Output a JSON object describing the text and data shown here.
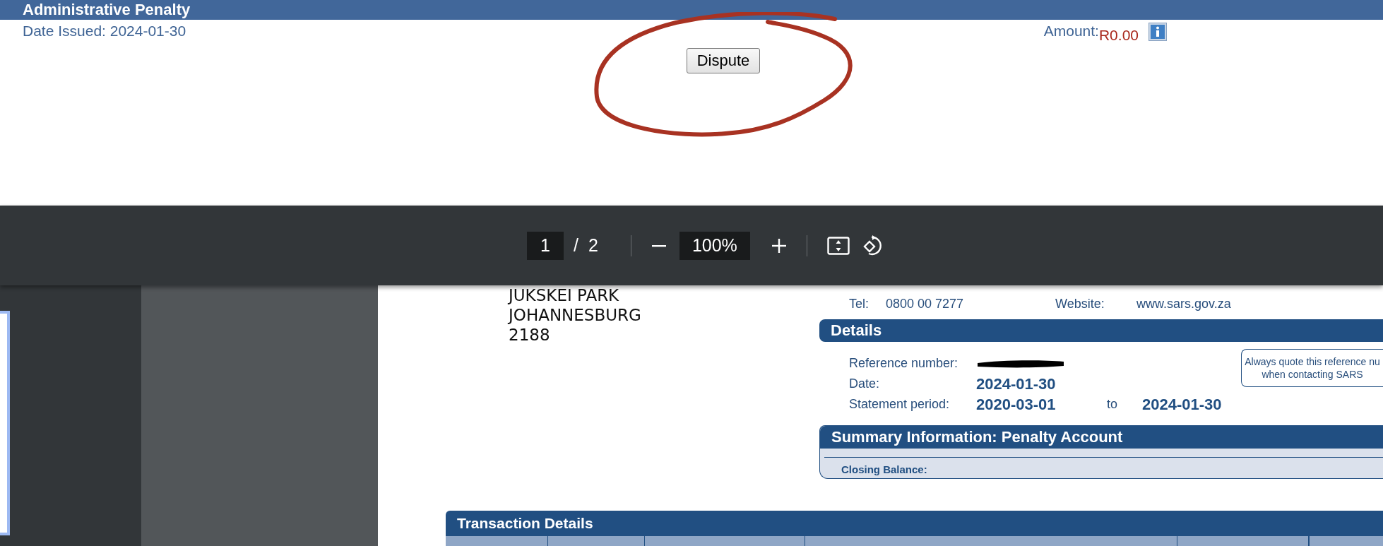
{
  "header": {
    "title": "Administrative Penalty",
    "date_issued": "Date Issued: 2024-01-30",
    "amount_label": "Amount:",
    "amount_value": "R0.00"
  },
  "dispute_button": {
    "label": "Dispute"
  },
  "pdf_toolbar": {
    "page_current": "1",
    "page_separator": "/",
    "page_total": "2",
    "zoom": "100%"
  },
  "sidebar": {
    "thumbnails": [
      {
        "selected": true
      }
    ]
  },
  "document": {
    "address_lines": [
      "JUKSKEI PARK",
      "JOHANNESBURG",
      "2188"
    ],
    "contact": [
      {
        "label": "Tel:",
        "value": "0800 00 7277"
      },
      {
        "label": "Website:",
        "value": "www.sars.gov.za"
      }
    ],
    "details": {
      "heading": "Details",
      "rows": [
        {
          "kind": "redacted",
          "label": "Reference number:"
        },
        {
          "kind": "value",
          "label": "Date:",
          "value": "2024-01-30"
        },
        {
          "kind": "range",
          "label": "Statement period:",
          "value": "2020-03-01",
          "joiner": "to",
          "end": "2024-01-30"
        }
      ],
      "note": [
        "Always quote this reference nu",
        "when contacting SARS"
      ]
    },
    "summary": {
      "heading": "Summary Information: Penalty Account",
      "rows": [
        "Closing Balance:"
      ]
    },
    "transactions": {
      "heading": "Transaction Details"
    }
  }
}
